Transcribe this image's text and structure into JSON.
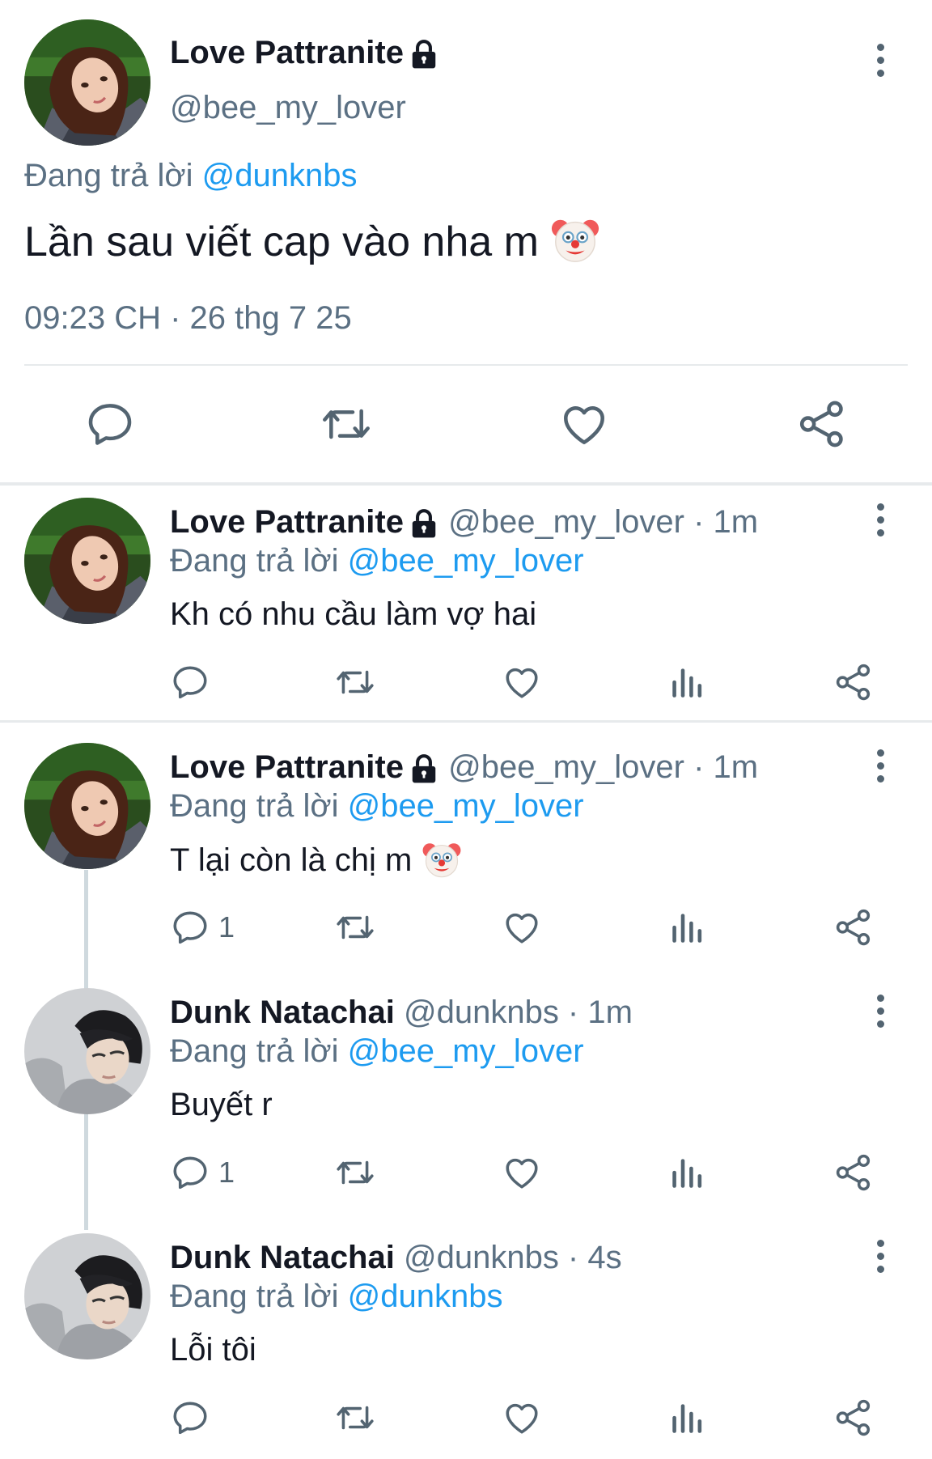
{
  "main_tweet": {
    "name": "Love Pattranite",
    "handle": "@bee_my_lover",
    "replying_prefix": "Đang trả lời",
    "replying_to": "@dunknbs",
    "text": "Lần sau viết cap vào nha m",
    "timestamp": "09:23 CH · 26 thg 7 25"
  },
  "replies": [
    {
      "name": "Love Pattranite",
      "meta": "@bee_my_lover · 1m",
      "replying_prefix": "Đang trả lời",
      "replying_to": "@bee_my_lover",
      "text": "Kh có nhu cầu làm vợ hai",
      "reply_count": ""
    },
    {
      "name": "Love Pattranite",
      "meta": "@bee_my_lover · 1m",
      "replying_prefix": "Đang trả lời",
      "replying_to": "@bee_my_lover",
      "text": "T lại còn là chị m",
      "reply_count": "1"
    },
    {
      "name": "Dunk Natachai",
      "meta": "@dunknbs · 1m",
      "replying_prefix": "Đang trả lời",
      "replying_to": "@bee_my_lover",
      "text": "Buyết r",
      "reply_count": "1"
    },
    {
      "name": "Dunk Natachai",
      "meta": "@dunknbs · 4s",
      "replying_prefix": "Đang trả lời",
      "replying_to": "@dunknbs",
      "text": "Lỗi tôi",
      "reply_count": ""
    }
  ],
  "icons": {
    "lock": "lock-icon",
    "clown": "clown-face-emoji",
    "reply": "reply-icon",
    "retweet": "retweet-icon",
    "like": "heart-icon",
    "views": "views-icon",
    "share": "share-icon",
    "more": "more-options-icon"
  },
  "colors": {
    "link": "#1d9bf0",
    "text": "#141823",
    "muted": "#5b7083",
    "icon": "#536471",
    "divider": "#e7eaec"
  }
}
